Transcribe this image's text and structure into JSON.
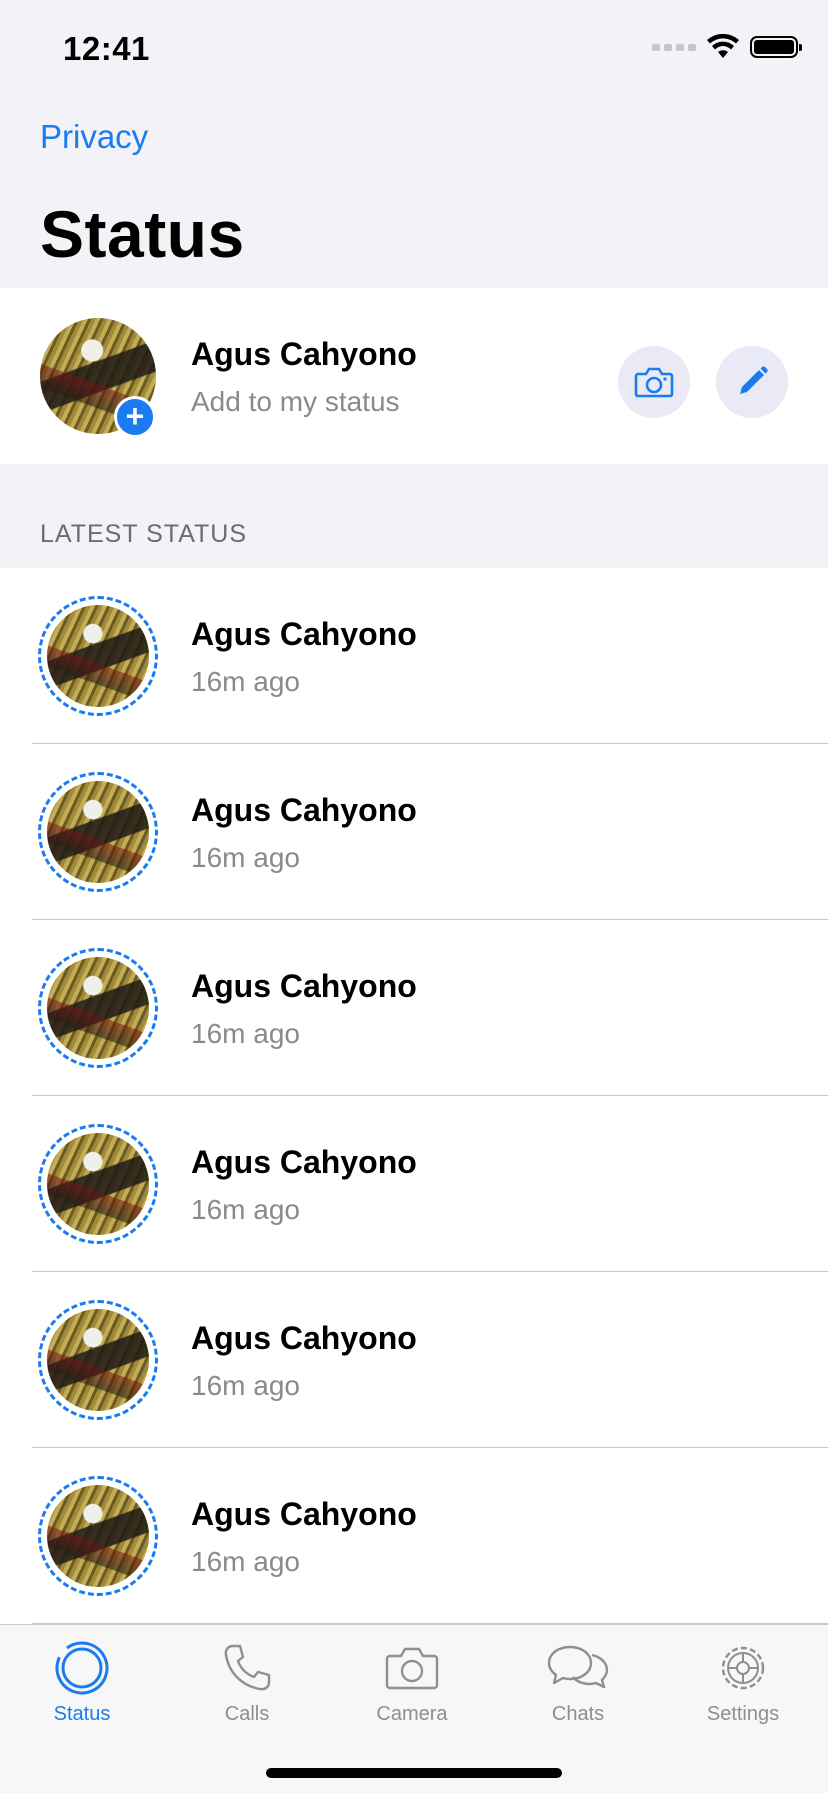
{
  "status_bar": {
    "time": "12:41"
  },
  "header": {
    "privacy_link": "Privacy",
    "title": "Status"
  },
  "my_status": {
    "name": "Agus Cahyono",
    "subtitle": "Add to my status",
    "add_badge": "+",
    "camera_button_icon": "camera-icon",
    "edit_button_icon": "pencil-icon"
  },
  "latest": {
    "header": "LATEST STATUS",
    "items": [
      {
        "name": "Agus Cahyono",
        "time": "16m ago"
      },
      {
        "name": "Agus Cahyono",
        "time": "16m ago"
      },
      {
        "name": "Agus Cahyono",
        "time": "16m ago"
      },
      {
        "name": "Agus Cahyono",
        "time": "16m ago"
      },
      {
        "name": "Agus Cahyono",
        "time": "16m ago"
      },
      {
        "name": "Agus Cahyono",
        "time": "16m ago"
      }
    ]
  },
  "tabs": [
    {
      "label": "Status",
      "icon": "status-icon",
      "active": true
    },
    {
      "label": "Calls",
      "icon": "phone-icon",
      "active": false
    },
    {
      "label": "Camera",
      "icon": "camera-icon",
      "active": false
    },
    {
      "label": "Chats",
      "icon": "chat-bubbles-icon",
      "active": false
    },
    {
      "label": "Settings",
      "icon": "gear-icon",
      "active": false
    }
  ],
  "colors": {
    "accent": "#1a7cf0",
    "secondary_text": "#8a8a8e",
    "background": "#f2f2f7"
  }
}
